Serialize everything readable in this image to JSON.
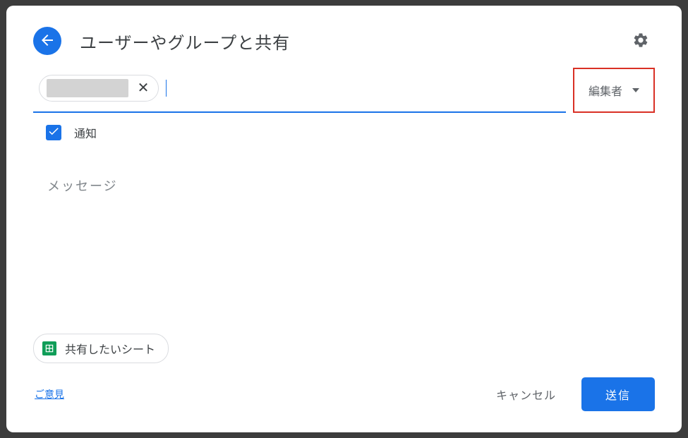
{
  "header": {
    "title": "ユーザーやグループと共有"
  },
  "role_selector": {
    "selected": "編集者"
  },
  "notify": {
    "label": "通知",
    "checked": true
  },
  "message": {
    "placeholder": "メッセージ"
  },
  "attachment": {
    "name": "共有したいシート"
  },
  "footer": {
    "feedback": "ご意見",
    "cancel": "キャンセル",
    "send": "送信"
  }
}
